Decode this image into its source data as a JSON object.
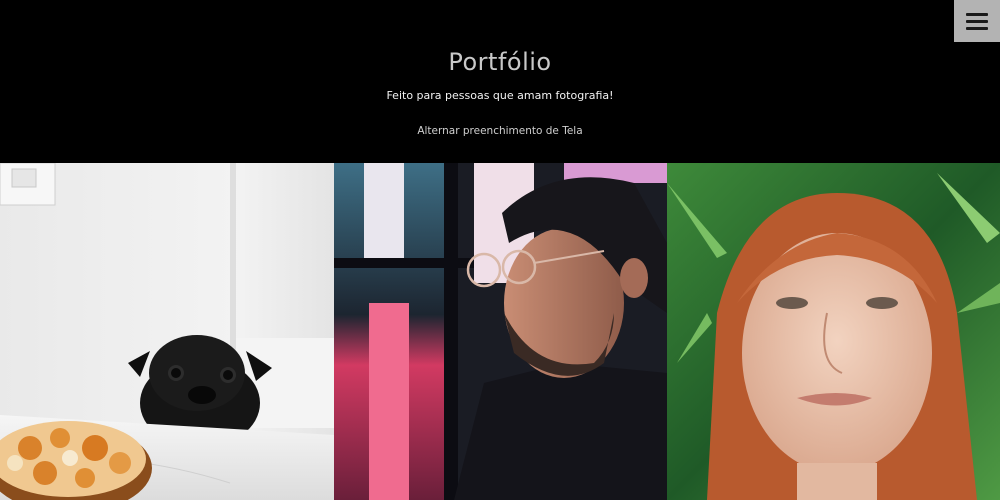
{
  "header": {
    "title": "Portfólio",
    "subtitle": "Feito para pessoas que amam fotografia!",
    "toggle_label": "Alternar preenchimento de Tela"
  },
  "menu": {
    "icon": "hamburger-menu-icon"
  },
  "gallery": {
    "photos": [
      {
        "subject": "black pug beside a pie on a marble table"
      },
      {
        "subject": "bearded man with glasses and beanie in neon light"
      },
      {
        "subject": "red-haired woman among green leaves"
      }
    ]
  },
  "colors": {
    "background": "#000000",
    "menu_button": "#b3b3b3"
  }
}
